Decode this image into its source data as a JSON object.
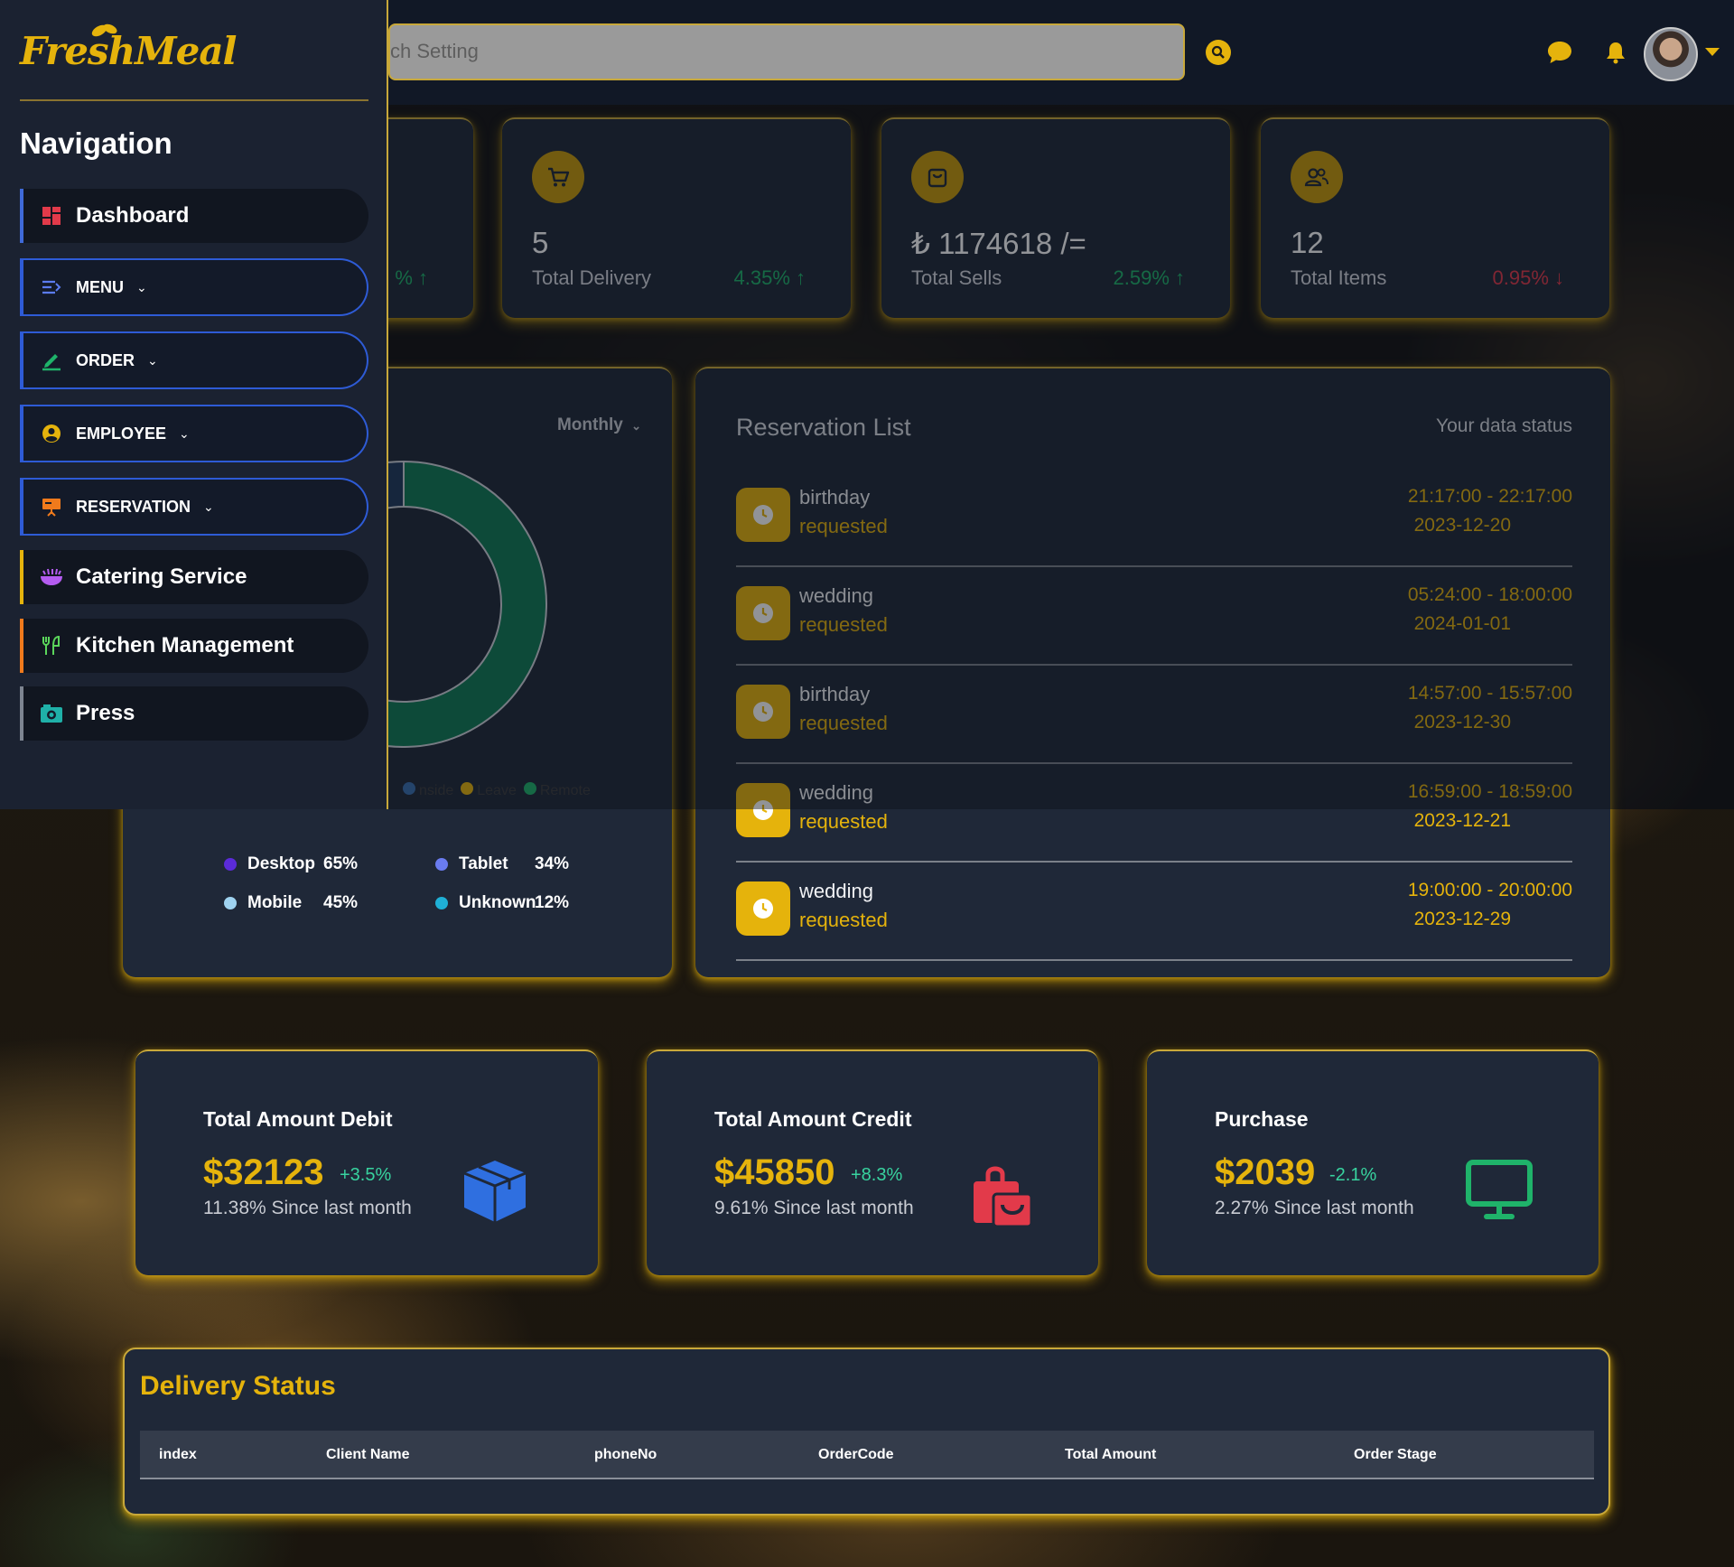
{
  "app": {
    "logo_text": "FreshMeal"
  },
  "search": {
    "placeholder": "ch Setting"
  },
  "header": {
    "icons": [
      "search-icon",
      "chat-icon",
      "bell-icon",
      "avatar"
    ]
  },
  "sidebar": {
    "title": "Navigation",
    "items": [
      {
        "label": "Dashboard",
        "icon": "dashboard-icon",
        "accent": "#3f6ad8",
        "dropdown": false
      },
      {
        "label": "MENU",
        "icon": "menu-icon",
        "accent": "#2e5bd6",
        "dropdown": true
      },
      {
        "label": "ORDER",
        "icon": "pencil-icon",
        "accent": "#2e5bd6",
        "dropdown": true
      },
      {
        "label": "EMPLOYEE",
        "icon": "user-circle-icon",
        "accent": "#2e5bd6",
        "dropdown": true
      },
      {
        "label": "RESERVATION",
        "icon": "presentation-icon",
        "accent": "#2e5bd6",
        "dropdown": true
      },
      {
        "label": "Catering Service",
        "icon": "food-bowl-icon",
        "accent": "#e5b30c",
        "dropdown": false
      },
      {
        "label": "Kitchen Management",
        "icon": "utensils-icon",
        "accent": "#f07a1c",
        "dropdown": false
      },
      {
        "label": "Press",
        "icon": "camera-icon",
        "accent": "#7d8490",
        "dropdown": false
      }
    ]
  },
  "stats": [
    {
      "partial_change": "% ↑"
    },
    {
      "value": "5",
      "label": "Total Delivery",
      "change": "4.35% ↑",
      "trend": "up",
      "icon": "cart-icon"
    },
    {
      "value": "₺ 1174618 /=",
      "label": "Total Sells",
      "change": "2.59% ↑",
      "trend": "up",
      "icon": "shopping-bag-icon"
    },
    {
      "value": "12",
      "label": "Total Items",
      "change": "0.95% ↓",
      "trend": "down",
      "icon": "users-icon"
    }
  ],
  "device_card": {
    "period": "Monthly",
    "mini_legend": [
      "nside",
      "Leave",
      "Remote"
    ],
    "legend": [
      {
        "name": "Desktop",
        "pct": "65%",
        "color": "#5b2bd9"
      },
      {
        "name": "Tablet",
        "pct": "34%",
        "color": "#6a7cf0"
      },
      {
        "name": "Mobile",
        "pct": "45%",
        "color": "#9fd3f0"
      },
      {
        "name": "Unknown",
        "pct": "12%",
        "color": "#1fb0d6"
      }
    ]
  },
  "chart_data": {
    "type": "pie",
    "labels": [
      "nside",
      "Leave",
      "Remote"
    ],
    "values": [
      6,
      28,
      66
    ],
    "colors": [
      "#3a6fb0",
      "#1f3a5c",
      "#0f7a55"
    ]
  },
  "reservations": {
    "title": "Reservation List",
    "status_label": "Your data status",
    "rows": [
      {
        "type": "birthday",
        "status": "requested",
        "time": "21:17:00 - 22:17:00",
        "date": "2023-12-20"
      },
      {
        "type": "wedding",
        "status": "requested",
        "time": "05:24:00 - 18:00:00",
        "date": "2024-01-01"
      },
      {
        "type": "birthday",
        "status": "requested",
        "time": "14:57:00 - 15:57:00",
        "date": "2023-12-30"
      },
      {
        "type": "wedding",
        "status": "requested",
        "time": "16:59:00 - 18:59:00",
        "date": "2023-12-21"
      },
      {
        "type": "wedding",
        "status": "requested",
        "time": "19:00:00 - 20:00:00",
        "date": "2023-12-29"
      }
    ]
  },
  "amounts": [
    {
      "title": "Total Amount Debit",
      "value": "$32123",
      "change": "+3.5%",
      "sub": "11.38% Since last month",
      "icon": "box-icon",
      "icon_color": "#2f6fe0"
    },
    {
      "title": "Total Amount Credit",
      "value": "$45850",
      "change": "+8.3%",
      "sub": "9.61% Since last month",
      "icon": "shopping-bag-icon",
      "icon_color": "#e23a4a"
    },
    {
      "title": "Purchase",
      "value": "$2039",
      "change": "-2.1%",
      "sub": "2.27% Since last month",
      "icon": "monitor-icon",
      "icon_color": "#1fb36a"
    }
  ],
  "delivery": {
    "title": "Delivery Status",
    "columns": [
      "index",
      "Client Name",
      "phoneNo",
      "OrderCode",
      "Total Amount",
      "Order Stage"
    ]
  },
  "colors": {
    "accent": "#e5b30c",
    "card": "#1f2838",
    "sidebar": "#1b2231"
  }
}
